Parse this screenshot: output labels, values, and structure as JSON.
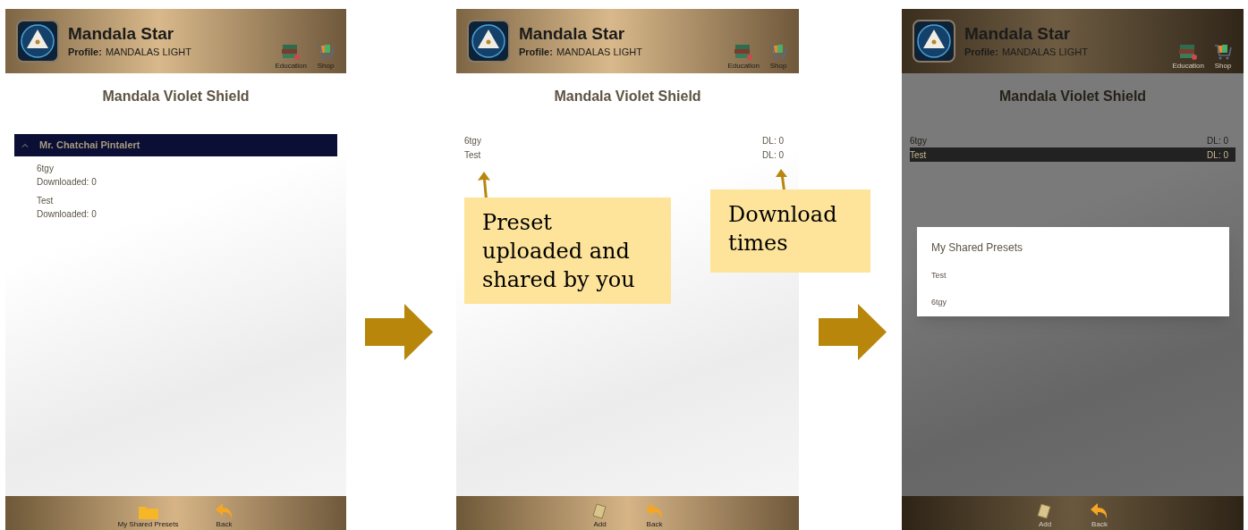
{
  "screens": [
    {
      "kind": "grouped",
      "dimmed": false,
      "header": {
        "app_name": "Mandala Star",
        "profile_label": "Profile:",
        "profile_name": "MANDALAS LIGHT",
        "buttons": [
          {
            "kind": "books",
            "label": "Education"
          },
          {
            "kind": "cart",
            "label": "Shop"
          }
        ]
      },
      "title": "Mandala Violet Shield",
      "group": {
        "owner": "Mr. Chatchai Pintalert",
        "expanded": true,
        "items": [
          {
            "name": "6tgy",
            "downloads": "Downloaded: 0"
          },
          {
            "name": "Test",
            "downloads": "Downloaded: 0"
          }
        ]
      },
      "bottom_bar": [
        {
          "kind": "folder",
          "label": "My Shared Presets"
        },
        {
          "kind": "back",
          "label": "Back"
        }
      ]
    },
    {
      "kind": "list",
      "dimmed": false,
      "header": {
        "app_name": "Mandala Star",
        "profile_label": "Profile:",
        "profile_name": "MANDALAS LIGHT",
        "buttons": [
          {
            "kind": "books",
            "label": "Education"
          },
          {
            "kind": "cart",
            "label": "Shop"
          }
        ]
      },
      "title": "Mandala Violet Shield",
      "rows": [
        {
          "name": "6tgy",
          "downloads": "DL: 0",
          "selected": false
        },
        {
          "name": "Test",
          "downloads": "DL: 0",
          "selected": false
        }
      ],
      "bottom_bar": [
        {
          "kind": "add",
          "label": "Add"
        },
        {
          "kind": "back",
          "label": "Back"
        }
      ]
    },
    {
      "kind": "list",
      "dimmed": true,
      "header": {
        "app_name": "Mandala Star",
        "profile_label": "Profile:",
        "profile_name": "MANDALAS LIGHT",
        "buttons": [
          {
            "kind": "books",
            "label": "Education"
          },
          {
            "kind": "cart",
            "label": "Shop"
          }
        ]
      },
      "title": "Mandala Violet Shield",
      "rows": [
        {
          "name": "6tgy",
          "downloads": "DL: 0",
          "selected": false
        },
        {
          "name": "Test",
          "downloads": "DL: 0",
          "selected": true
        }
      ],
      "dialog": {
        "title": "My Shared Presets",
        "items": [
          "Test",
          "6tgy"
        ]
      },
      "bottom_bar": [
        {
          "kind": "add",
          "label": "Add"
        },
        {
          "kind": "back",
          "label": "Back"
        }
      ]
    }
  ],
  "callouts": [
    {
      "lines": [
        "Preset",
        "uploaded and",
        "shared by you"
      ]
    },
    {
      "lines": [
        "Download",
        "times"
      ]
    }
  ]
}
